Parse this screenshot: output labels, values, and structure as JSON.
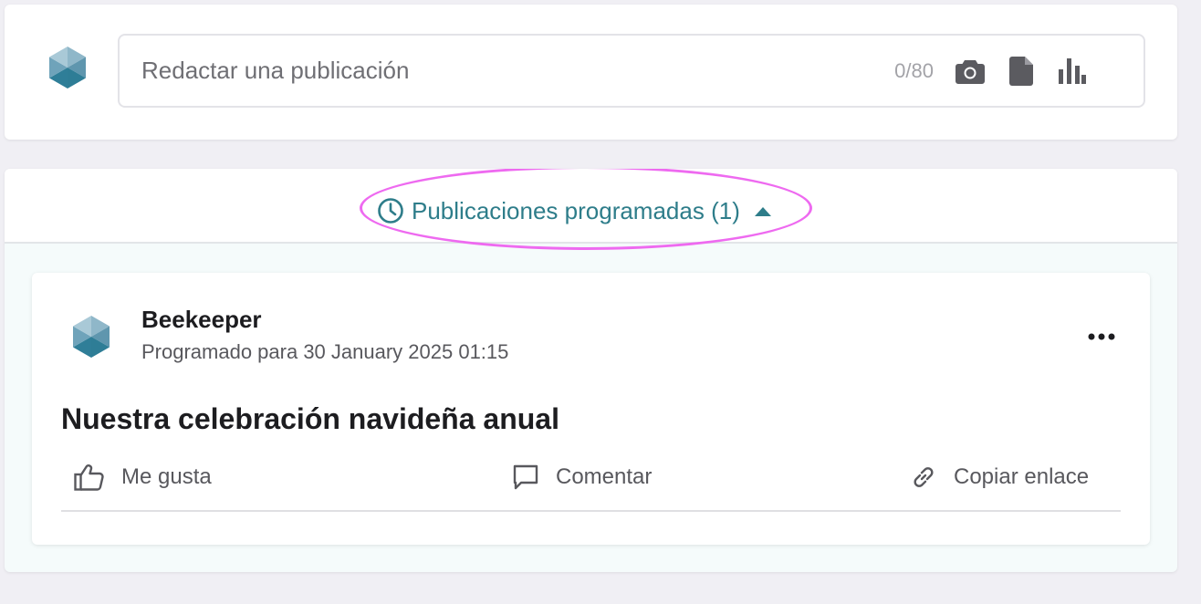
{
  "composer": {
    "placeholder": "Redactar una publicación",
    "char_count": "0/80",
    "icons": [
      "camera-icon",
      "document-icon",
      "bar-chart-icon"
    ]
  },
  "scheduled": {
    "toggle_label": "Publicaciones programadas (1)",
    "icon": "clock-icon",
    "caret": "caret-up-icon"
  },
  "post": {
    "author": "Beekeeper",
    "schedule_text": "Programado para 30 January 2025 01:15",
    "title": "Nuestra celebración navideña anual",
    "actions": {
      "like": "Me gusta",
      "comment": "Comentar",
      "copy_link": "Copiar enlace"
    }
  },
  "colors": {
    "accent": "#2e7d8a",
    "highlight": "#ee6af0",
    "background": "#f0eff4"
  }
}
